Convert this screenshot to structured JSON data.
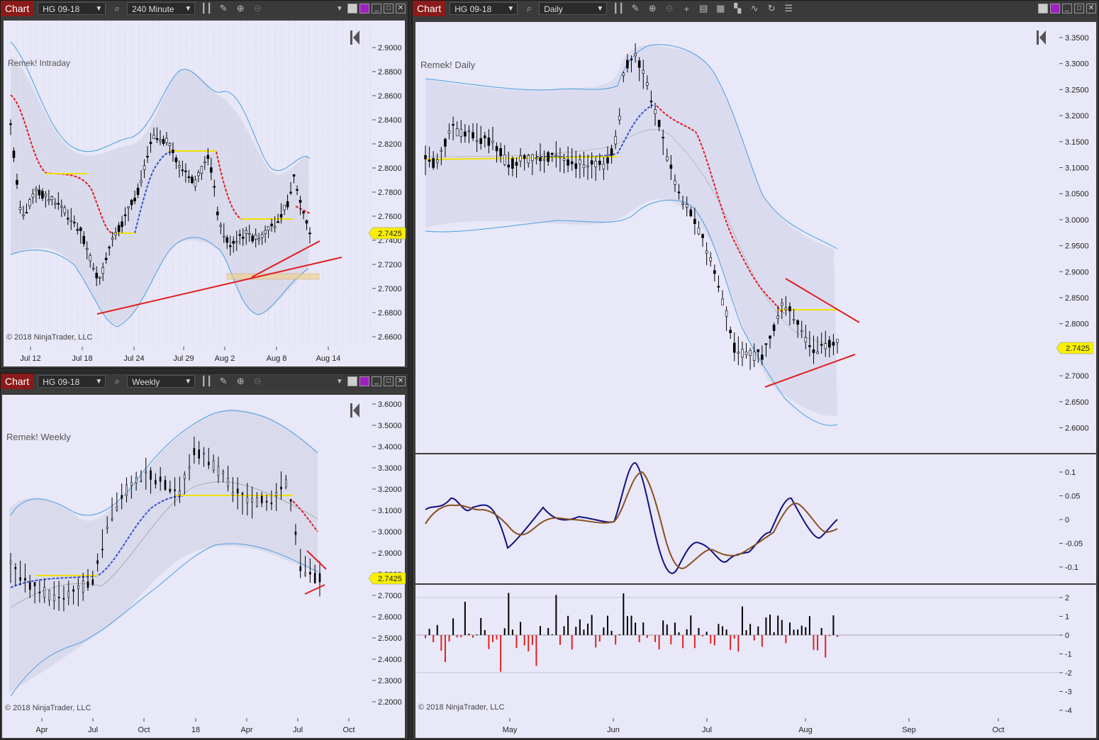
{
  "charts": {
    "intraday": {
      "window_title": "Chart",
      "instrument": "HG 09-18",
      "interval": "240 Minute",
      "watermark": "Remek! Intraday",
      "copyright": "© 2018 NinjaTrader, LLC",
      "price_label": "2.7425",
      "y_ticks": [
        "2.9000",
        "2.8800",
        "2.8600",
        "2.8400",
        "2.8200",
        "2.8000",
        "2.7800",
        "2.7600",
        "2.7400",
        "2.7200",
        "2.7000",
        "2.6800",
        "2.6600"
      ],
      "x_ticks": [
        "Jul 12",
        "Jul 18",
        "Jul 24",
        "Jul 29",
        "Aug 2",
        "Aug 8",
        "Aug 14"
      ]
    },
    "weekly": {
      "window_title": "Chart",
      "instrument": "HG 09-18",
      "interval": "Weekly",
      "watermark": "Remek! Weekly",
      "copyright": "© 2018 NinjaTrader, LLC",
      "price_label": "2.7425",
      "y_ticks": [
        "3.6000",
        "3.5000",
        "3.4000",
        "3.3000",
        "3.2000",
        "3.1000",
        "3.0000",
        "2.9000",
        "2.8000",
        "2.7000",
        "2.6000",
        "2.5000",
        "2.4000",
        "2.3000",
        "2.2000"
      ],
      "x_ticks": [
        "Apr",
        "Jul",
        "Oct",
        "18",
        "Apr",
        "Jul",
        "Oct"
      ]
    },
    "daily": {
      "window_title": "Chart",
      "instrument": "HG 09-18",
      "interval": "Daily",
      "watermark": "Remek! Daily",
      "copyright": "© 2018 NinjaTrader, LLC",
      "price_label": "2.7425",
      "y_ticks": [
        "3.3500",
        "3.3000",
        "3.2500",
        "3.2000",
        "3.1500",
        "3.1000",
        "3.0500",
        "3.0000",
        "2.9500",
        "2.9000",
        "2.8500",
        "2.8000",
        "2.7500",
        "2.7000",
        "2.6500",
        "2.6000"
      ],
      "osc_ticks": [
        "0.1",
        "0.05",
        "0",
        "-0.05",
        "-0.1"
      ],
      "hist_ticks": [
        "2",
        "1",
        "0",
        "-1",
        "-2",
        "-3",
        "-4"
      ],
      "x_ticks": [
        "May",
        "Jun",
        "Jul",
        "Aug",
        "Sep",
        "Oct"
      ]
    }
  },
  "colors": {
    "candle": "#000000",
    "band": "#4a9fe0",
    "ma_up": "#3355cc",
    "ma_down": "#e02020",
    "trend": "#e02020",
    "pivot": "#f0e000",
    "osc_fast": "#101080",
    "osc_slow": "#8a5020",
    "hist_up": "#000000",
    "hist_down": "#e02020"
  },
  "icons": [
    "search-icon",
    "bar-type-icon",
    "pencil-icon",
    "zoom-in-icon",
    "zoom-out-icon",
    "crosshair-icon",
    "properties-icon",
    "data-box-icon",
    "strategies-icon",
    "indicators-icon",
    "reload-icon",
    "list-icon",
    "minimize-icon",
    "restore-icon",
    "close-icon"
  ]
}
